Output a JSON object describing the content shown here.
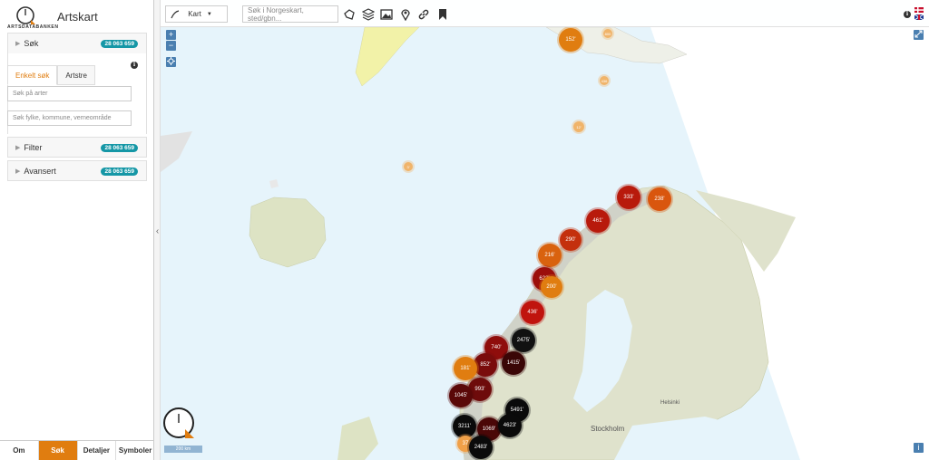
{
  "app": {
    "title": "Artskart",
    "logo_text": "ARTSDATABANKEN"
  },
  "sidebar": {
    "sok": {
      "label": "Søk",
      "count": "28 063 659"
    },
    "tabs": [
      "Enkelt søk",
      "Artstre"
    ],
    "species_placeholder": "Søk på arter",
    "area_placeholder": "Søk fylke, kommune, verneområde",
    "filter": {
      "label": "Filter",
      "count": "28 063 659"
    },
    "avansert": {
      "label": "Avansert",
      "count": "28 063 659"
    }
  },
  "bottom_nav": [
    "Om",
    "Søk",
    "Detaljer",
    "Symboler"
  ],
  "toolbar": {
    "map_select": "Kart",
    "search_placeholder": "Søk i Norgeskart, sted/gbn...",
    "icons": [
      "polygon-icon",
      "layers-icon",
      "image-icon",
      "pin-icon",
      "link-icon",
      "bookmark-icon"
    ]
  },
  "map": {
    "scale": "200 km",
    "places": [
      "Stockholm",
      "Helsinki"
    ],
    "zoom_in": "+",
    "zoom_out": "−",
    "clusters": [
      {
        "label": "152'",
        "color": "#e07d10"
      },
      {
        "label": "800",
        "color": "#f0b46a"
      },
      {
        "label": "436",
        "color": "#f0b46a"
      },
      {
        "label": "12'",
        "color": "#f0b46a"
      },
      {
        "label": "3'",
        "color": "#f0b46a"
      },
      {
        "label": "333'",
        "color": "#b81a0c"
      },
      {
        "label": "238'",
        "color": "#d9560e"
      },
      {
        "label": "461'",
        "color": "#b81a0c"
      },
      {
        "label": "290'",
        "color": "#c4300d"
      },
      {
        "label": "216'",
        "color": "#d9620e"
      },
      {
        "label": "622'",
        "color": "#9c0f0c"
      },
      {
        "label": "200'",
        "color": "#e07d10"
      },
      {
        "label": "436'",
        "color": "#c0140e"
      },
      {
        "label": "2475'",
        "color": "#111111"
      },
      {
        "label": "740'",
        "color": "#8f0d0c"
      },
      {
        "label": "852'",
        "color": "#7a0c0c"
      },
      {
        "label": "1415'",
        "color": "#3a0606"
      },
      {
        "label": "181'",
        "color": "#e07d10"
      },
      {
        "label": "993'",
        "color": "#6e0b0b"
      },
      {
        "label": "1045'",
        "color": "#5a0808"
      },
      {
        "label": "5491'",
        "color": "#0a0a0a"
      },
      {
        "label": "3211'",
        "color": "#0a0a0a"
      },
      {
        "label": "1069'",
        "color": "#4a0707"
      },
      {
        "label": "4623'",
        "color": "#0a0a0a"
      },
      {
        "label": "37",
        "color": "#f0a048"
      },
      {
        "label": "2483'",
        "color": "#0a0a0a"
      }
    ]
  }
}
